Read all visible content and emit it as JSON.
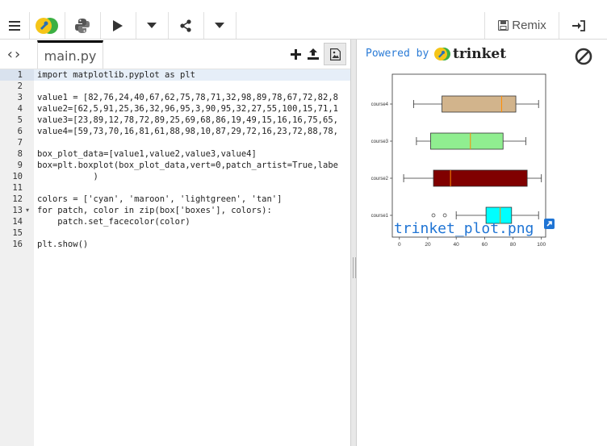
{
  "toolbar": {
    "menu_icon": "hamburger-icon",
    "remix_label": "Remix",
    "accent": "#f5c518"
  },
  "editor": {
    "file_tab": "main.py",
    "line_numbers": [
      "1",
      "2",
      "3",
      "4",
      "5",
      "6",
      "7",
      "8",
      "9",
      "10",
      "11",
      "12",
      "13",
      "14",
      "15",
      "16"
    ],
    "code": [
      {
        "ln": "1",
        "text": "import matplotlib.pyplot as plt"
      },
      {
        "ln": "2",
        "text": ""
      },
      {
        "ln": "3",
        "text": "value1 = [82,76,24,40,67,62,75,78,71,32,98,89,78,67,72,82,8"
      },
      {
        "ln": "4",
        "text": "value2=[62,5,91,25,36,32,96,95,3,90,95,32,27,55,100,15,71,1"
      },
      {
        "ln": "5",
        "text": "value3=[23,89,12,78,72,89,25,69,68,86,19,49,15,16,16,75,65,"
      },
      {
        "ln": "6",
        "text": "value4=[59,73,70,16,81,61,88,98,10,87,29,72,16,23,72,88,78,"
      },
      {
        "ln": "7",
        "text": ""
      },
      {
        "ln": "8",
        "text": "box_plot_data=[value1,value2,value3,value4]"
      },
      {
        "ln": "9",
        "text": "box=plt.boxplot(box_plot_data,vert=0,patch_artist=True,labe"
      },
      {
        "ln": "10",
        "text": "           )"
      },
      {
        "ln": "11",
        "text": ""
      },
      {
        "ln": "12",
        "text": "colors = ['cyan', 'maroon', 'lightgreen', 'tan']"
      },
      {
        "ln": "13",
        "text": "for patch, color in zip(box['boxes'], colors):"
      },
      {
        "ln": "14",
        "text": "    patch.set_facecolor(color)"
      },
      {
        "ln": "15",
        "text": ""
      },
      {
        "ln": "16",
        "text": "plt.show()"
      }
    ]
  },
  "output": {
    "powered_by": "Powered by",
    "brand": "trinket",
    "caption": "trinket_plot.png"
  },
  "chart_data": {
    "type": "boxplot",
    "orientation": "horizontal",
    "categories": [
      "course1",
      "course2",
      "course3",
      "course4"
    ],
    "xlim": [
      0,
      100
    ],
    "xticks": [
      "0",
      "20",
      "40",
      "60",
      "80",
      "100"
    ],
    "boxes": [
      {
        "label": "course1",
        "color": "#00ffff",
        "whislo": 40,
        "q1": 61,
        "med": 71,
        "q3": 79,
        "whishi": 98,
        "fliers": [
          24,
          32
        ]
      },
      {
        "label": "course2",
        "color": "#800000",
        "whislo": 3,
        "q1": 24,
        "med": 36,
        "q3": 90,
        "whishi": 100,
        "fliers": []
      },
      {
        "label": "course3",
        "color": "#90ee90",
        "whislo": 12,
        "q1": 22,
        "med": 50,
        "q3": 73,
        "whishi": 89,
        "fliers": []
      },
      {
        "label": "course4",
        "color": "#d2b48c",
        "whislo": 10,
        "q1": 30,
        "med": 72,
        "q3": 82,
        "whishi": 98,
        "fliers": []
      }
    ],
    "median_color": "#ff8c00"
  }
}
